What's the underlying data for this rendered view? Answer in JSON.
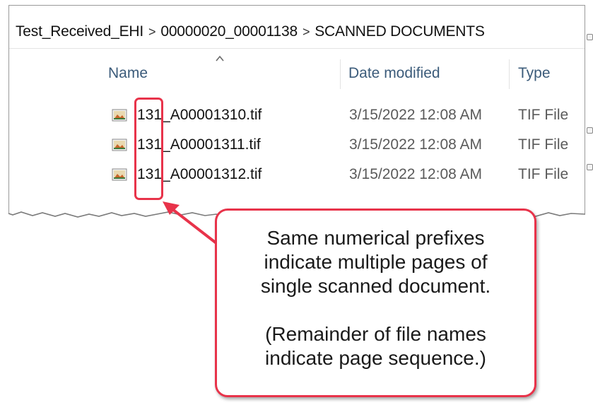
{
  "breadcrumb": {
    "items": [
      "Test_Received_EHI",
      "00000020_00001138",
      "SCANNED DOCUMENTS"
    ],
    "separator": ">"
  },
  "columns": {
    "name": "Name",
    "date_modified": "Date modified",
    "type": "Type",
    "sort_indicator": "caret-up-icon"
  },
  "files": [
    {
      "name": "131_A00001310.tif",
      "date": "3/15/2022 12:08 AM",
      "type": "TIF File",
      "icon": "tif-image-file-icon"
    },
    {
      "name": "131_A00001311.tif",
      "date": "3/15/2022 12:08 AM",
      "type": "TIF File",
      "icon": "tif-image-file-icon"
    },
    {
      "name": "131_A00001312.tif",
      "date": "3/15/2022 12:08 AM",
      "type": "TIF File",
      "icon": "tif-image-file-icon"
    }
  ],
  "callout": {
    "line1": "Same numerical prefixes",
    "line2": "indicate multiple pages of",
    "line3": "single scanned document.",
    "line4": "(Remainder of file names",
    "line5": "indicate page sequence.)"
  },
  "colors": {
    "highlight": "#e8334a",
    "header_text": "#3b5b7a",
    "secondary_text": "#5a5a5a"
  }
}
